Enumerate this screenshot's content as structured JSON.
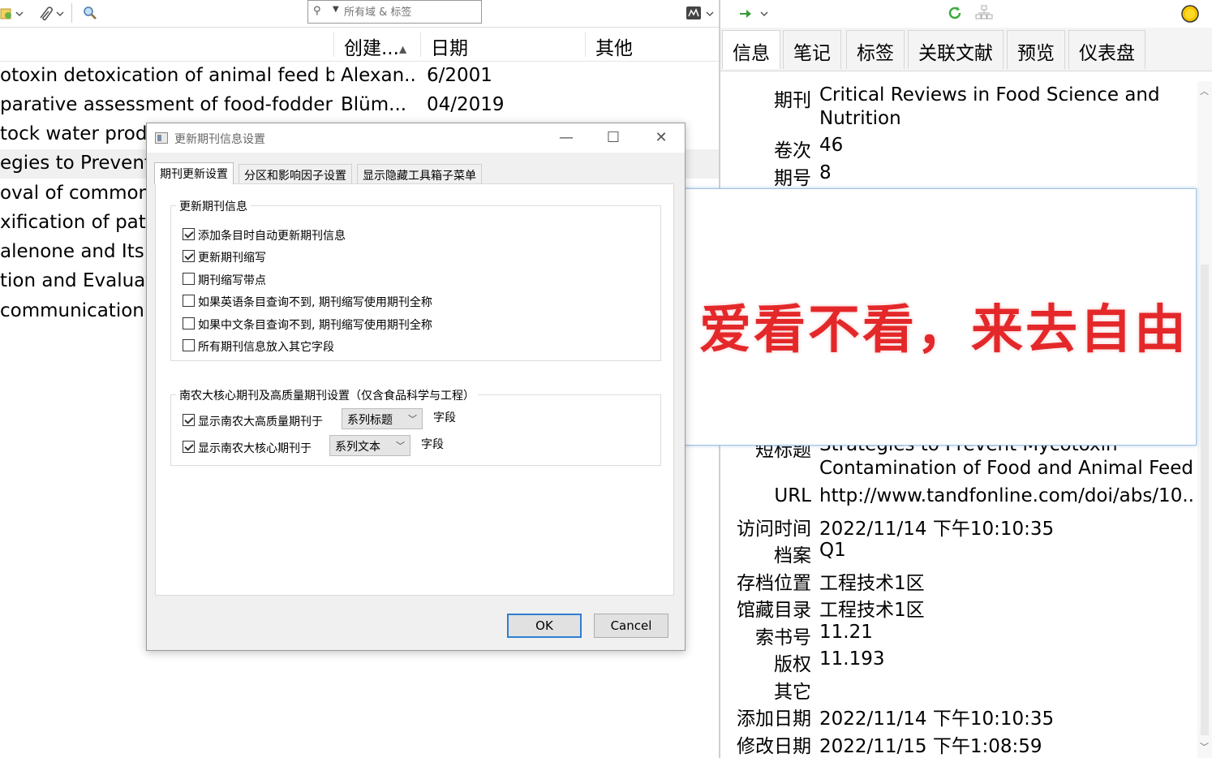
{
  "toolbar": {
    "search_placeholder": "所有域 & 标签"
  },
  "list": {
    "columns": {
      "creator": "创建...",
      "date": "日期",
      "other": "其他",
      "sort_indicator": "▲"
    },
    "rows": [
      {
        "title": "otoxin detoxication of animal feed b...",
        "creator": "Alexan...",
        "date": "6/2001"
      },
      {
        "title": "parative assessment of food-fodder ...",
        "creator": "Blüm...",
        "date": "04/2019"
      },
      {
        "title": "tock water produ",
        "creator": "",
        "date": ""
      },
      {
        "title": "egies to Prevent M",
        "creator": "",
        "date": ""
      },
      {
        "title": "oval of common F",
        "creator": "",
        "date": ""
      },
      {
        "title": "xification of patul",
        "creator": "",
        "date": ""
      },
      {
        "title": "alenone and Its D",
        "creator": "",
        "date": ""
      },
      {
        "title": "tion and Evaluati",
        "creator": "",
        "date": ""
      },
      {
        "title": " communication:",
        "creator": "",
        "date": ""
      }
    ]
  },
  "right_tabs": [
    "信息",
    "笔记",
    "标签",
    "关联文献",
    "预览",
    "仪表盘"
  ],
  "info_top": [
    {
      "label": "期刊",
      "value": "Critical Reviews in Food Science and",
      "value2": "Nutrition"
    },
    {
      "label": "卷次",
      "value": "46"
    },
    {
      "label": "期号",
      "value": "8"
    }
  ],
  "info_bottom": {
    "short_title_label": "短标题",
    "short_title_1": "Strategies to Prevent Mycotoxin",
    "short_title_2": "Contamination of Food and Animal Feed",
    "fields": [
      {
        "label": "URL",
        "value": "http://www.tandfonline.com/doi/abs/10...."
      },
      {
        "label": "访问时间",
        "value": "2022/11/14 下午10:10:35"
      },
      {
        "label": "档案",
        "value": "Q1"
      },
      {
        "label": "存档位置",
        "value": "工程技术1区"
      },
      {
        "label": "馆藏目录",
        "value": "工程技术1区"
      },
      {
        "label": "索书号",
        "value": "11.21"
      },
      {
        "label": "版权",
        "value": "11.193"
      },
      {
        "label": "其它",
        "value": ""
      },
      {
        "label": "添加日期",
        "value": "2022/11/14 下午10:10:35"
      },
      {
        "label": "修改日期",
        "value": "2022/11/15 下午1:08:59"
      }
    ]
  },
  "overlay": {
    "slogan": "爱看不看，来去自由"
  },
  "dialog": {
    "title": "更新期刊信息设置",
    "tabs": [
      "期刊更新设置",
      "分区和影响因子设置",
      "显示隐藏工具箱子菜单"
    ],
    "group1": {
      "label": "更新期刊信息",
      "options": [
        {
          "label": "添加条目时自动更新期刊信息",
          "checked": true
        },
        {
          "label": "更新期刊缩写",
          "checked": true
        },
        {
          "label": "期刊缩写带点",
          "checked": false
        },
        {
          "label": "如果英语条目查询不到, 期刊缩写使用期刊全称",
          "checked": false
        },
        {
          "label": "如果中文条目查询不到, 期刊缩写使用期刊全称",
          "checked": false
        },
        {
          "label": "所有期刊信息放入其它字段",
          "checked": false
        }
      ]
    },
    "group2": {
      "label": "南农大核心期刊及高质量期刊设置（仅含食品科学与工程）",
      "row1": {
        "label": "显示南农大高质量期刊于",
        "checked": true,
        "select": "系列标题",
        "suffix": "字段"
      },
      "row2": {
        "label": "显示南农大核心期刊于",
        "checked": true,
        "select": "系列文本",
        "suffix": "字段"
      }
    },
    "ok": "OK",
    "cancel": "Cancel"
  },
  "colors": {
    "accent": "#2f7fd0",
    "slogan": "#e4282a"
  }
}
